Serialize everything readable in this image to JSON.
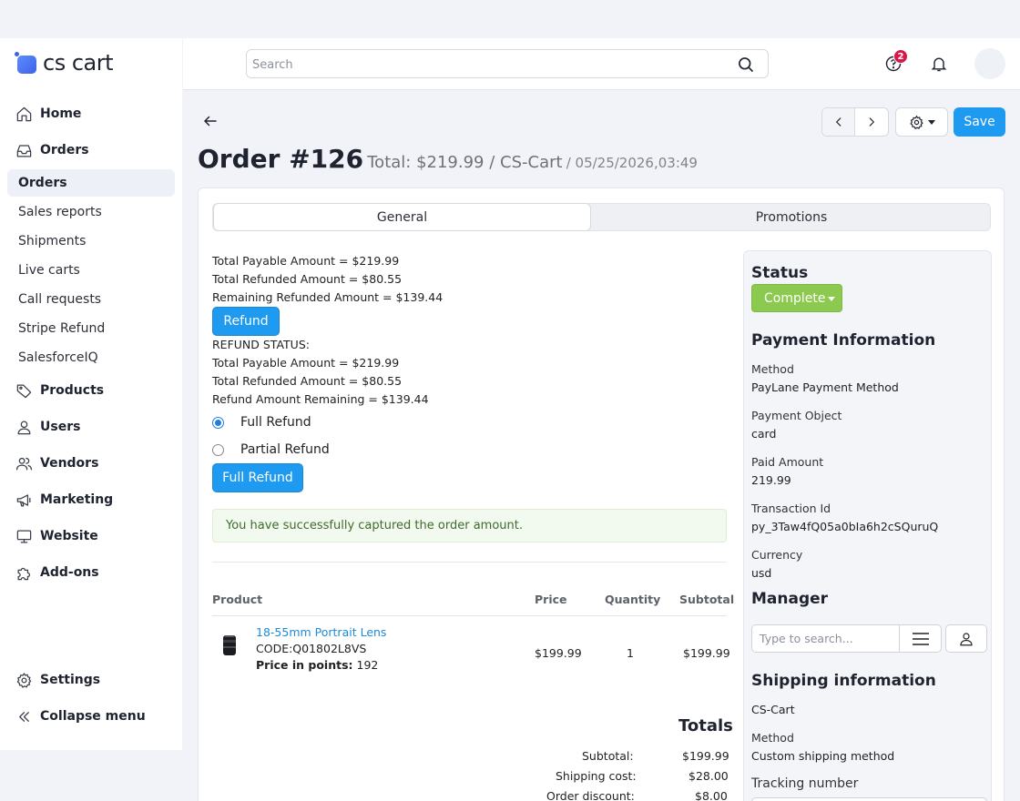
{
  "brand": {
    "name": "cs cart"
  },
  "header": {
    "search_placeholder": "Search",
    "help_badge": "2"
  },
  "sidebar": {
    "home": "Home",
    "orders": "Orders",
    "orders_sub": [
      "Orders",
      "Sales reports",
      "Shipments",
      "Live carts",
      "Call requests",
      "Stripe Refund",
      "SalesforceIQ"
    ],
    "products": "Products",
    "users": "Users",
    "vendors": "Vendors",
    "marketing": "Marketing",
    "website": "Website",
    "addons": "Add-ons",
    "settings": "Settings",
    "collapse": "Collapse menu"
  },
  "toolbar": {
    "save_label": "Save"
  },
  "order": {
    "title": "Order #126",
    "total": "Total: $219.99 / CS-Cart",
    "date": "/ 05/25/2026,03:49"
  },
  "tabs": {
    "general": "General",
    "promotions": "Promotions"
  },
  "refund": {
    "lines_top": [
      "Total Payable Amount = $219.99",
      "Total Refunded Amount = $80.55",
      "Remaining Refunded Amount = $139.44"
    ],
    "refund_button": "Refund",
    "status_title": "REFUND STATUS:",
    "lines_status": [
      "Total Payable Amount = $219.99",
      "Total Refunded Amount = $80.55",
      "Refund Amount Remaining = $139.44"
    ],
    "option_full": "Full Refund",
    "option_partial": "Partial Refund",
    "submit_label": "Full Refund"
  },
  "success_message": "You have successfully captured the order amount.",
  "products_table": {
    "headers": {
      "product": "Product",
      "price": "Price",
      "quantity": "Quantity",
      "subtotal": "Subtotal"
    },
    "rows": [
      {
        "name": "18-55mm Portrait Lens",
        "code": "CODE:Q01802L8VS",
        "points_label": "Price in points:",
        "points": "192",
        "price": "$199.99",
        "quantity": "1",
        "subtotal": "$199.99"
      }
    ]
  },
  "totals": {
    "title": "Totals",
    "rows": [
      {
        "label": "Subtotal:",
        "value": "$199.99"
      },
      {
        "label": "Shipping cost:",
        "value": "$28.00"
      },
      {
        "label": "Order discount:",
        "value": "$8.00"
      }
    ]
  },
  "side": {
    "status_title": "Status",
    "status_value": "Complete",
    "payment_title": "Payment Information",
    "payment": [
      {
        "label": "Method",
        "value": "PayLane Payment Method"
      },
      {
        "label": "Payment Object",
        "value": "card"
      },
      {
        "label": "Paid Amount",
        "value": "219.99"
      },
      {
        "label": "Transaction Id",
        "value": "py_3Taw4fQ05a0bIa6h2cSQuruQ"
      },
      {
        "label": "Currency",
        "value": "usd"
      }
    ],
    "manager_title": "Manager",
    "manager_placeholder": "Type to search...",
    "shipping_title": "Shipping information",
    "shipping_carrier": "CS-Cart",
    "shipping_method_label": "Method",
    "shipping_method_value": "Custom shipping method",
    "tracking_label": "Tracking number"
  },
  "colors": {
    "accent": "#1e9af0",
    "status_complete": "#8bc94f",
    "badge": "#d8184a",
    "link": "#1e8ad6"
  }
}
